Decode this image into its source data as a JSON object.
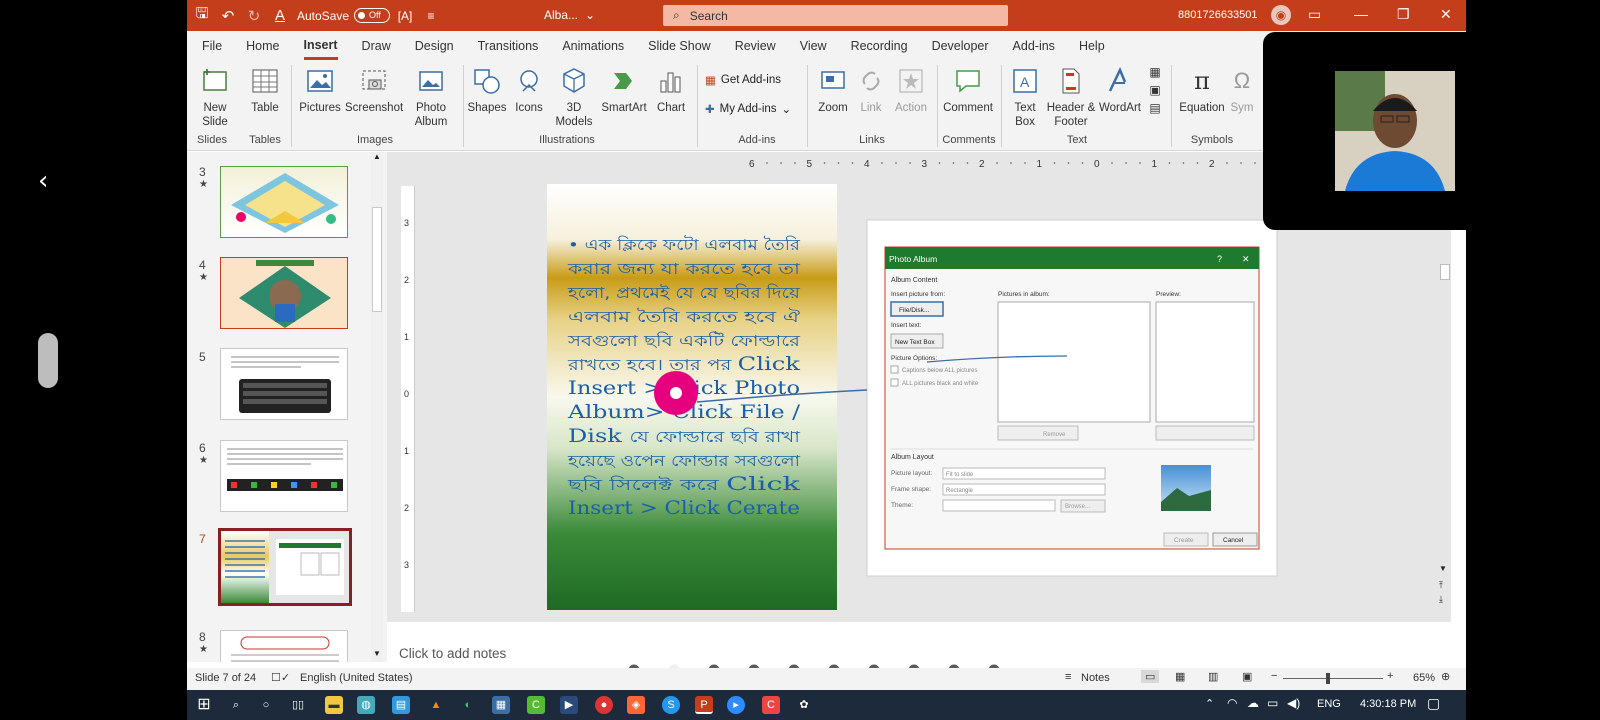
{
  "titlebar": {
    "autosave_label": "AutoSave",
    "autosave_state": "Off",
    "doc_title": "Alba...",
    "search_placeholder": "Search",
    "account": "8801726633501"
  },
  "menu": [
    "File",
    "Home",
    "Insert",
    "Draw",
    "Design",
    "Transitions",
    "Animations",
    "Slide Show",
    "Review",
    "View",
    "Recording",
    "Developer",
    "Add-ins",
    "Help"
  ],
  "ribbon": {
    "new_slide": "New Slide",
    "table": "Table",
    "pictures": "Pictures",
    "screenshot": "Screenshot",
    "photo_album": "Photo Album",
    "shapes": "Shapes",
    "icons": "Icons",
    "models_3d": "3D Models",
    "smartart": "SmartArt",
    "chart": "Chart",
    "get_addins": "Get Add-ins",
    "my_addins": "My Add-ins",
    "zoom": "Zoom",
    "link": "Link",
    "action": "Action",
    "comment": "Comment",
    "text_box": "Text Box",
    "header_footer": "Header & Footer",
    "wordart": "WordArt",
    "equation": "Equation",
    "symbol": "Sym",
    "groups": {
      "slides": "Slides",
      "tables": "Tables",
      "images": "Images",
      "illustrations": "Illustrations",
      "addins": "Add-ins",
      "links": "Links",
      "comments": "Comments",
      "text": "Text",
      "symbols": "Symbols"
    }
  },
  "thumbnails": [
    {
      "num": "3",
      "star": "★"
    },
    {
      "num": "4",
      "star": "★"
    },
    {
      "num": "5",
      "star": ""
    },
    {
      "num": "6",
      "star": "★"
    },
    {
      "num": "7",
      "star": ""
    },
    {
      "num": "8",
      "star": "★"
    }
  ],
  "ruler": {
    "h": [
      "6",
      "5",
      "4",
      "3",
      "2",
      "1",
      "0",
      "1",
      "2",
      "3",
      "4",
      "5",
      "6"
    ],
    "v": [
      "3",
      "2",
      "1",
      "0",
      "1",
      "2",
      "3"
    ]
  },
  "slide": {
    "bengali_lines": [
      "• এক ক্লিকে ফটো এলবাম তৈরি",
      "করার জন্য যা করতে হবে তা",
      "হলো, প্রথমেই যে যে ছবির দিয়ে",
      "এলবাম তৈরি করতে হবে ঐ",
      "সবগুলো ছবি একটি ফোল্ডারে"
    ],
    "mixed_lines": [
      {
        "bn": "রাখতে হবে। তার পর",
        "en": "Click"
      },
      {
        "bn": "",
        "en": "Insert > Click Photo"
      },
      {
        "bn": "",
        "en": "Album> Click File /"
      },
      {
        "bn": "যে ফোল্ডারে ছবি রাখা",
        "en": "Disk"
      },
      {
        "bn": "হয়েছে ওপেন ফোল্ডার সবগুলো",
        "en": ""
      },
      {
        "bn": "ছবি সিলেক্ট করে",
        "en": "Click"
      },
      {
        "bn": "",
        "en": "Insert > Click Cerate"
      }
    ]
  },
  "dialog": {
    "title": "Photo Album",
    "help": "?",
    "close": "✕",
    "album_content": "Album Content",
    "insert_from": "Insert picture from:",
    "file_disk": "File/Disk...",
    "insert_text": "Insert text:",
    "new_text_box": "New Text Box",
    "picture_options": "Picture Options:",
    "captions": "Captions below ALL pictures",
    "black_white": "ALL pictures black and white",
    "pictures_in_album": "Pictures in album:",
    "preview": "Preview:",
    "remove": "Remove",
    "album_layout": "Album Layout",
    "picture_layout_label": "Picture layout:",
    "picture_layout_value": "Fit to slide",
    "frame_shape_label": "Frame shape:",
    "frame_shape_value": "Rectangle",
    "theme_label": "Theme:",
    "browse": "Browse...",
    "create": "Create",
    "cancel": "Cancel"
  },
  "notes_placeholder": "Click to add notes",
  "status": {
    "slide_info": "Slide 7 of 24",
    "language": "English (United States)",
    "notes_label": "Notes",
    "zoom": "65%"
  },
  "taskbar": {
    "lang": "ENG",
    "time": "4:30:18 PM"
  },
  "colors": {
    "accent": "#c43e1c",
    "dialog_green": "#1e7a2e",
    "slide_text": "#1a5fa8",
    "pointer": "#e6007e"
  }
}
